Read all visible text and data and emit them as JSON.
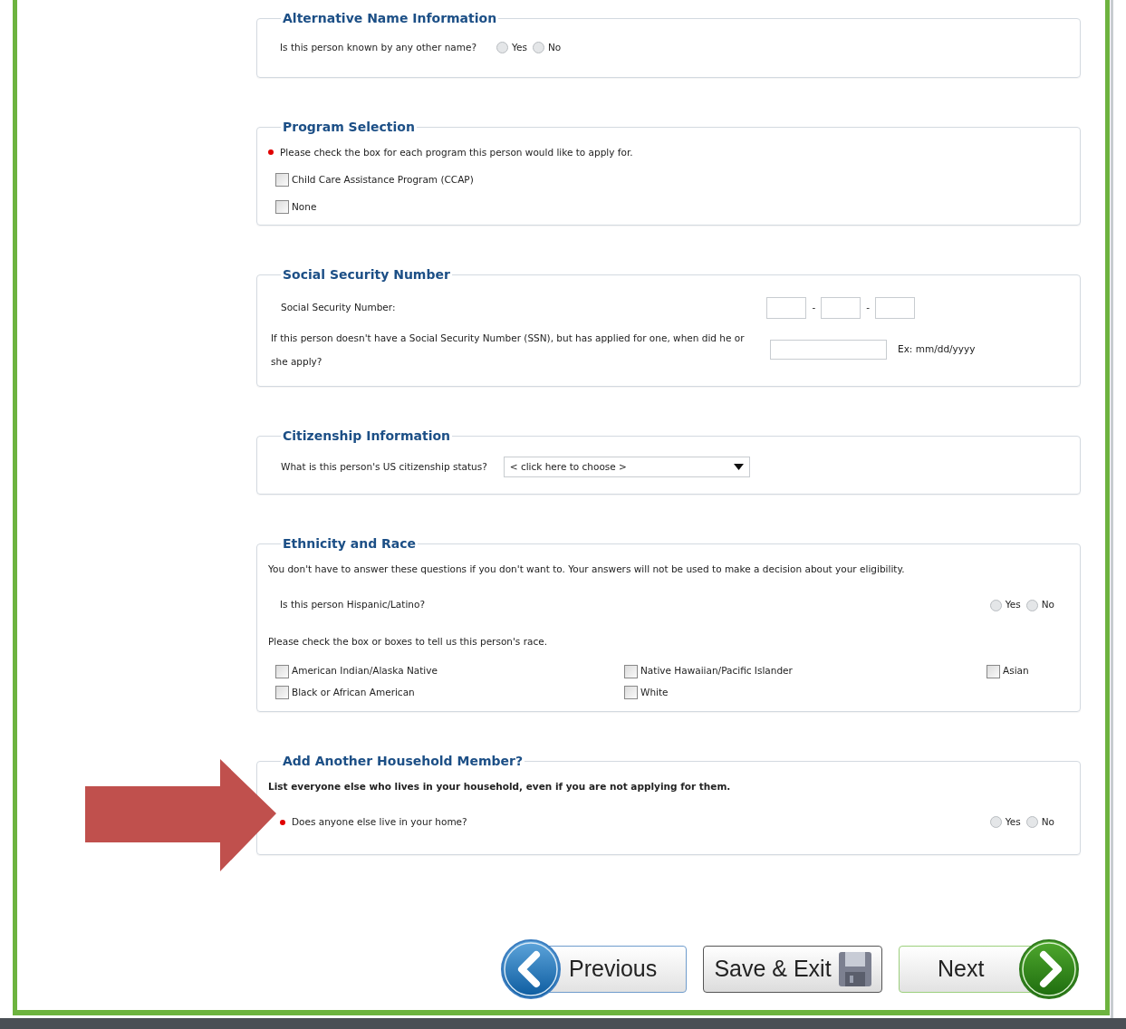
{
  "sections": [
    {
      "title": "Alternative Name Information",
      "rows": [
        {
          "kind": "radio_inline",
          "text": "Is this person known by any other name?",
          "required": false,
          "options": [
            {
              "label": "Yes",
              "selected": false
            },
            {
              "label": "No",
              "selected": false
            }
          ]
        }
      ]
    },
    {
      "title": "Program Selection",
      "rows": [
        {
          "kind": "note",
          "text": "Please check the box for each program this person would like to apply for.",
          "required": true,
          "bold": false
        },
        {
          "kind": "checklist",
          "items": [
            {
              "label": "Child Care Assistance Program (CCAP)",
              "checked": false
            },
            {
              "label": "None",
              "checked": false
            }
          ]
        }
      ]
    },
    {
      "title": "Social Security Number",
      "rows": [
        {
          "kind": "ssn",
          "text": "Social Security Number:",
          "separators": [
            "-",
            "-"
          ]
        },
        {
          "kind": "date",
          "text": "If this person doesn't have a Social Security Number (SSN), but has applied for one, when did he or she apply?",
          "hint": "Ex: mm/dd/yyyy"
        }
      ]
    },
    {
      "title": "Citizenship Information",
      "rows": [
        {
          "kind": "select",
          "text": "What is this person's US citizenship status?",
          "value": "< click here to choose >"
        }
      ]
    },
    {
      "title": "Ethnicity and Race",
      "rows": [
        {
          "kind": "note",
          "text": "You don't have to answer these questions if you don't want to. Your answers will not be used to make a decision about your eligibility.",
          "required": false,
          "bold": false
        },
        {
          "kind": "radio",
          "text": "Is this person Hispanic/Latino?",
          "required": false,
          "options": [
            {
              "label": "Yes",
              "selected": false
            },
            {
              "label": "No",
              "selected": false
            }
          ]
        },
        {
          "kind": "note",
          "text": "Please check the box or boxes to tell us this person's race.",
          "required": false,
          "bold": false
        },
        {
          "kind": "checkgrid",
          "items": [
            {
              "label": "American Indian/Alaska Native",
              "checked": false
            },
            {
              "label": "Native Hawaiian/Pacific Islander",
              "checked": false
            },
            {
              "label": "Asian",
              "checked": false
            },
            {
              "label": "Black or African American",
              "checked": false
            },
            {
              "label": "White",
              "checked": false
            }
          ]
        }
      ]
    },
    {
      "title": "Add Another Household Member?",
      "rows": [
        {
          "kind": "note",
          "text": "List everyone else who lives in your household, even if you are not applying for them.",
          "required": false,
          "bold": true
        },
        {
          "kind": "radio",
          "text": "Does anyone else live in your home?",
          "required": true,
          "options": [
            {
              "label": "Yes",
              "selected": false
            },
            {
              "label": "No",
              "selected": false
            }
          ]
        }
      ]
    }
  ],
  "buttons": [
    {
      "kind": "previous",
      "label": "Previous"
    },
    {
      "kind": "save",
      "label": "Save & Exit"
    },
    {
      "kind": "next",
      "label": "Next"
    }
  ]
}
